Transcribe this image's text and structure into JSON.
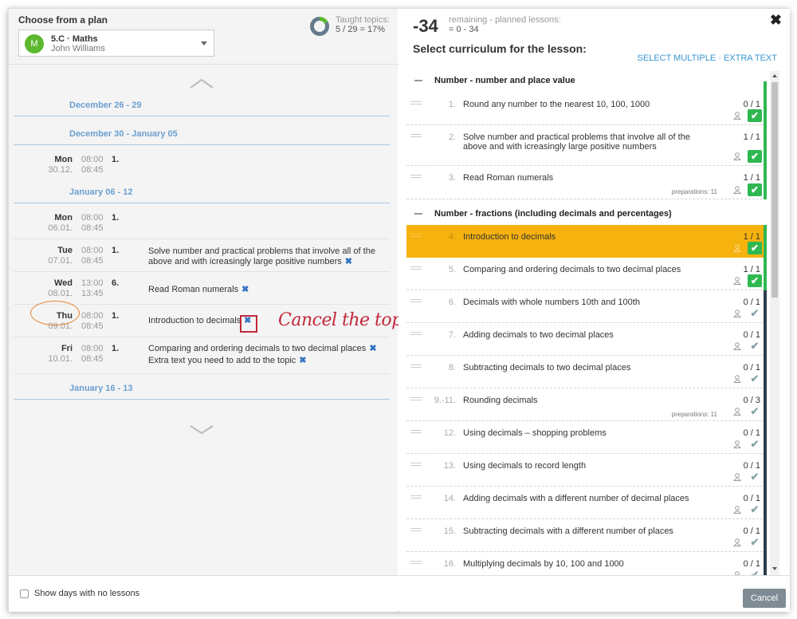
{
  "left": {
    "title": "Choose from a plan",
    "plan": {
      "avatar": "M",
      "name": "5.C · Maths",
      "teacher": "John Williams"
    },
    "taught": {
      "label": "Taught topics:",
      "value": "5 / 29 = 17%"
    },
    "weeks": [
      "December 26 - 29",
      "December 30 - January 05",
      "January 06 - 12",
      "January 16 - 13"
    ],
    "days": [
      {
        "name": "Mon",
        "date": "30.12.",
        "start": "08:00",
        "end": "08:45",
        "lesson": "1.",
        "topics": []
      },
      {
        "name": "Mon",
        "date": "06.01.",
        "start": "08:00",
        "end": "08:45",
        "lesson": "1.",
        "topics": []
      },
      {
        "name": "Tue",
        "date": "07.01.",
        "start": "08:00",
        "end": "08:45",
        "lesson": "1.",
        "topics": [
          "Solve number and practical problems that involve all of the above and with icreasingly large positive numbers"
        ]
      },
      {
        "name": "Wed",
        "date": "08.01.",
        "start": "13:00",
        "end": "13:45",
        "lesson": "6.",
        "topics": [
          "Read Roman numerals"
        ]
      },
      {
        "name": "Thu",
        "date": "09.01.",
        "start": "08:00",
        "end": "08:45",
        "lesson": "1.",
        "topics": [
          "Introduction to decimals"
        ]
      },
      {
        "name": "Fri",
        "date": "10.01.",
        "start": "08:00",
        "end": "08:45",
        "lesson": "1.",
        "topics": [
          "Comparing and ordering decimals to two decimal places",
          "Extra text you need to add to the topic"
        ]
      }
    ],
    "show_days_label": "Show days with no lessons"
  },
  "right": {
    "remaining_number": "-34",
    "remaining_label": "remaining - planned lessons:",
    "remaining_formula": "= 0 - 34",
    "title": "Select curriculum for the lesson:",
    "select_multiple": "SELECT MULTIPLE",
    "link_sep": "·",
    "extra_text": "EXTRA TEXT",
    "categories": [
      "Number - number and place value",
      "Number - fractions (including decimals and percentages)"
    ],
    "items": [
      {
        "num": "1.",
        "name": "Round any number to the nearest 10, 100, 1000",
        "count": "0 / 1",
        "prep": "",
        "done": true
      },
      {
        "num": "2.",
        "name": "Solve number and practical problems that involve all of the above and with icreasingly large positive numbers",
        "count": "1 / 1",
        "prep": "",
        "done": true
      },
      {
        "num": "3.",
        "name": "Read Roman numerals",
        "count": "1 / 1",
        "prep": "preparations: 11",
        "done": true
      },
      {
        "num": "4.",
        "name": "Introduction to decimals",
        "count": "1 / 1",
        "prep": "",
        "done": true
      },
      {
        "num": "5.",
        "name": "Comparing and ordering decimals to two decimal places",
        "count": "1 / 1",
        "prep": "",
        "done": true
      },
      {
        "num": "6.",
        "name": "Decimals with whole numbers 10th and 100th",
        "count": "0 / 1",
        "prep": "",
        "done": false
      },
      {
        "num": "7.",
        "name": "Adding decimals to two decimal places",
        "count": "0 / 1",
        "prep": "",
        "done": false
      },
      {
        "num": "8.",
        "name": "Subtracting decimals to two decimal places",
        "count": "0 / 1",
        "prep": "",
        "done": false
      },
      {
        "num": "9.-11.",
        "name": "Rounding decimals",
        "count": "0 / 3",
        "prep": "preparations: 11",
        "done": false
      },
      {
        "num": "12.",
        "name": "Using decimals – shopping problems",
        "count": "0 / 1",
        "prep": "",
        "done": false
      },
      {
        "num": "13.",
        "name": "Using decimals to record length",
        "count": "0 / 1",
        "prep": "",
        "done": false
      },
      {
        "num": "14.",
        "name": "Adding decimals with a different number of decimal places",
        "count": "0 / 1",
        "prep": "",
        "done": false
      },
      {
        "num": "15.",
        "name": "Subtracting decimals with a different number of places",
        "count": "0 / 1",
        "prep": "",
        "done": false
      },
      {
        "num": "16.",
        "name": "Multiplying decimals by 10, 100 and 1000",
        "count": "0 / 1",
        "prep": "",
        "done": false
      }
    ],
    "cancel": "Cancel"
  },
  "annotation": "Cancel the topic",
  "icons": {
    "close": "close-icon",
    "check": "check-icon",
    "remove": "remove-icon",
    "user": "user-icon",
    "drag": "drag-handle-icon",
    "collapse": "collapse-icon"
  },
  "colors": {
    "done": "#2fb851",
    "highlight": "#f6b20f",
    "link": "#3895d3",
    "week": "#6a9fd0",
    "annotation": "#c2283a",
    "avatar": "#5cb82f"
  }
}
